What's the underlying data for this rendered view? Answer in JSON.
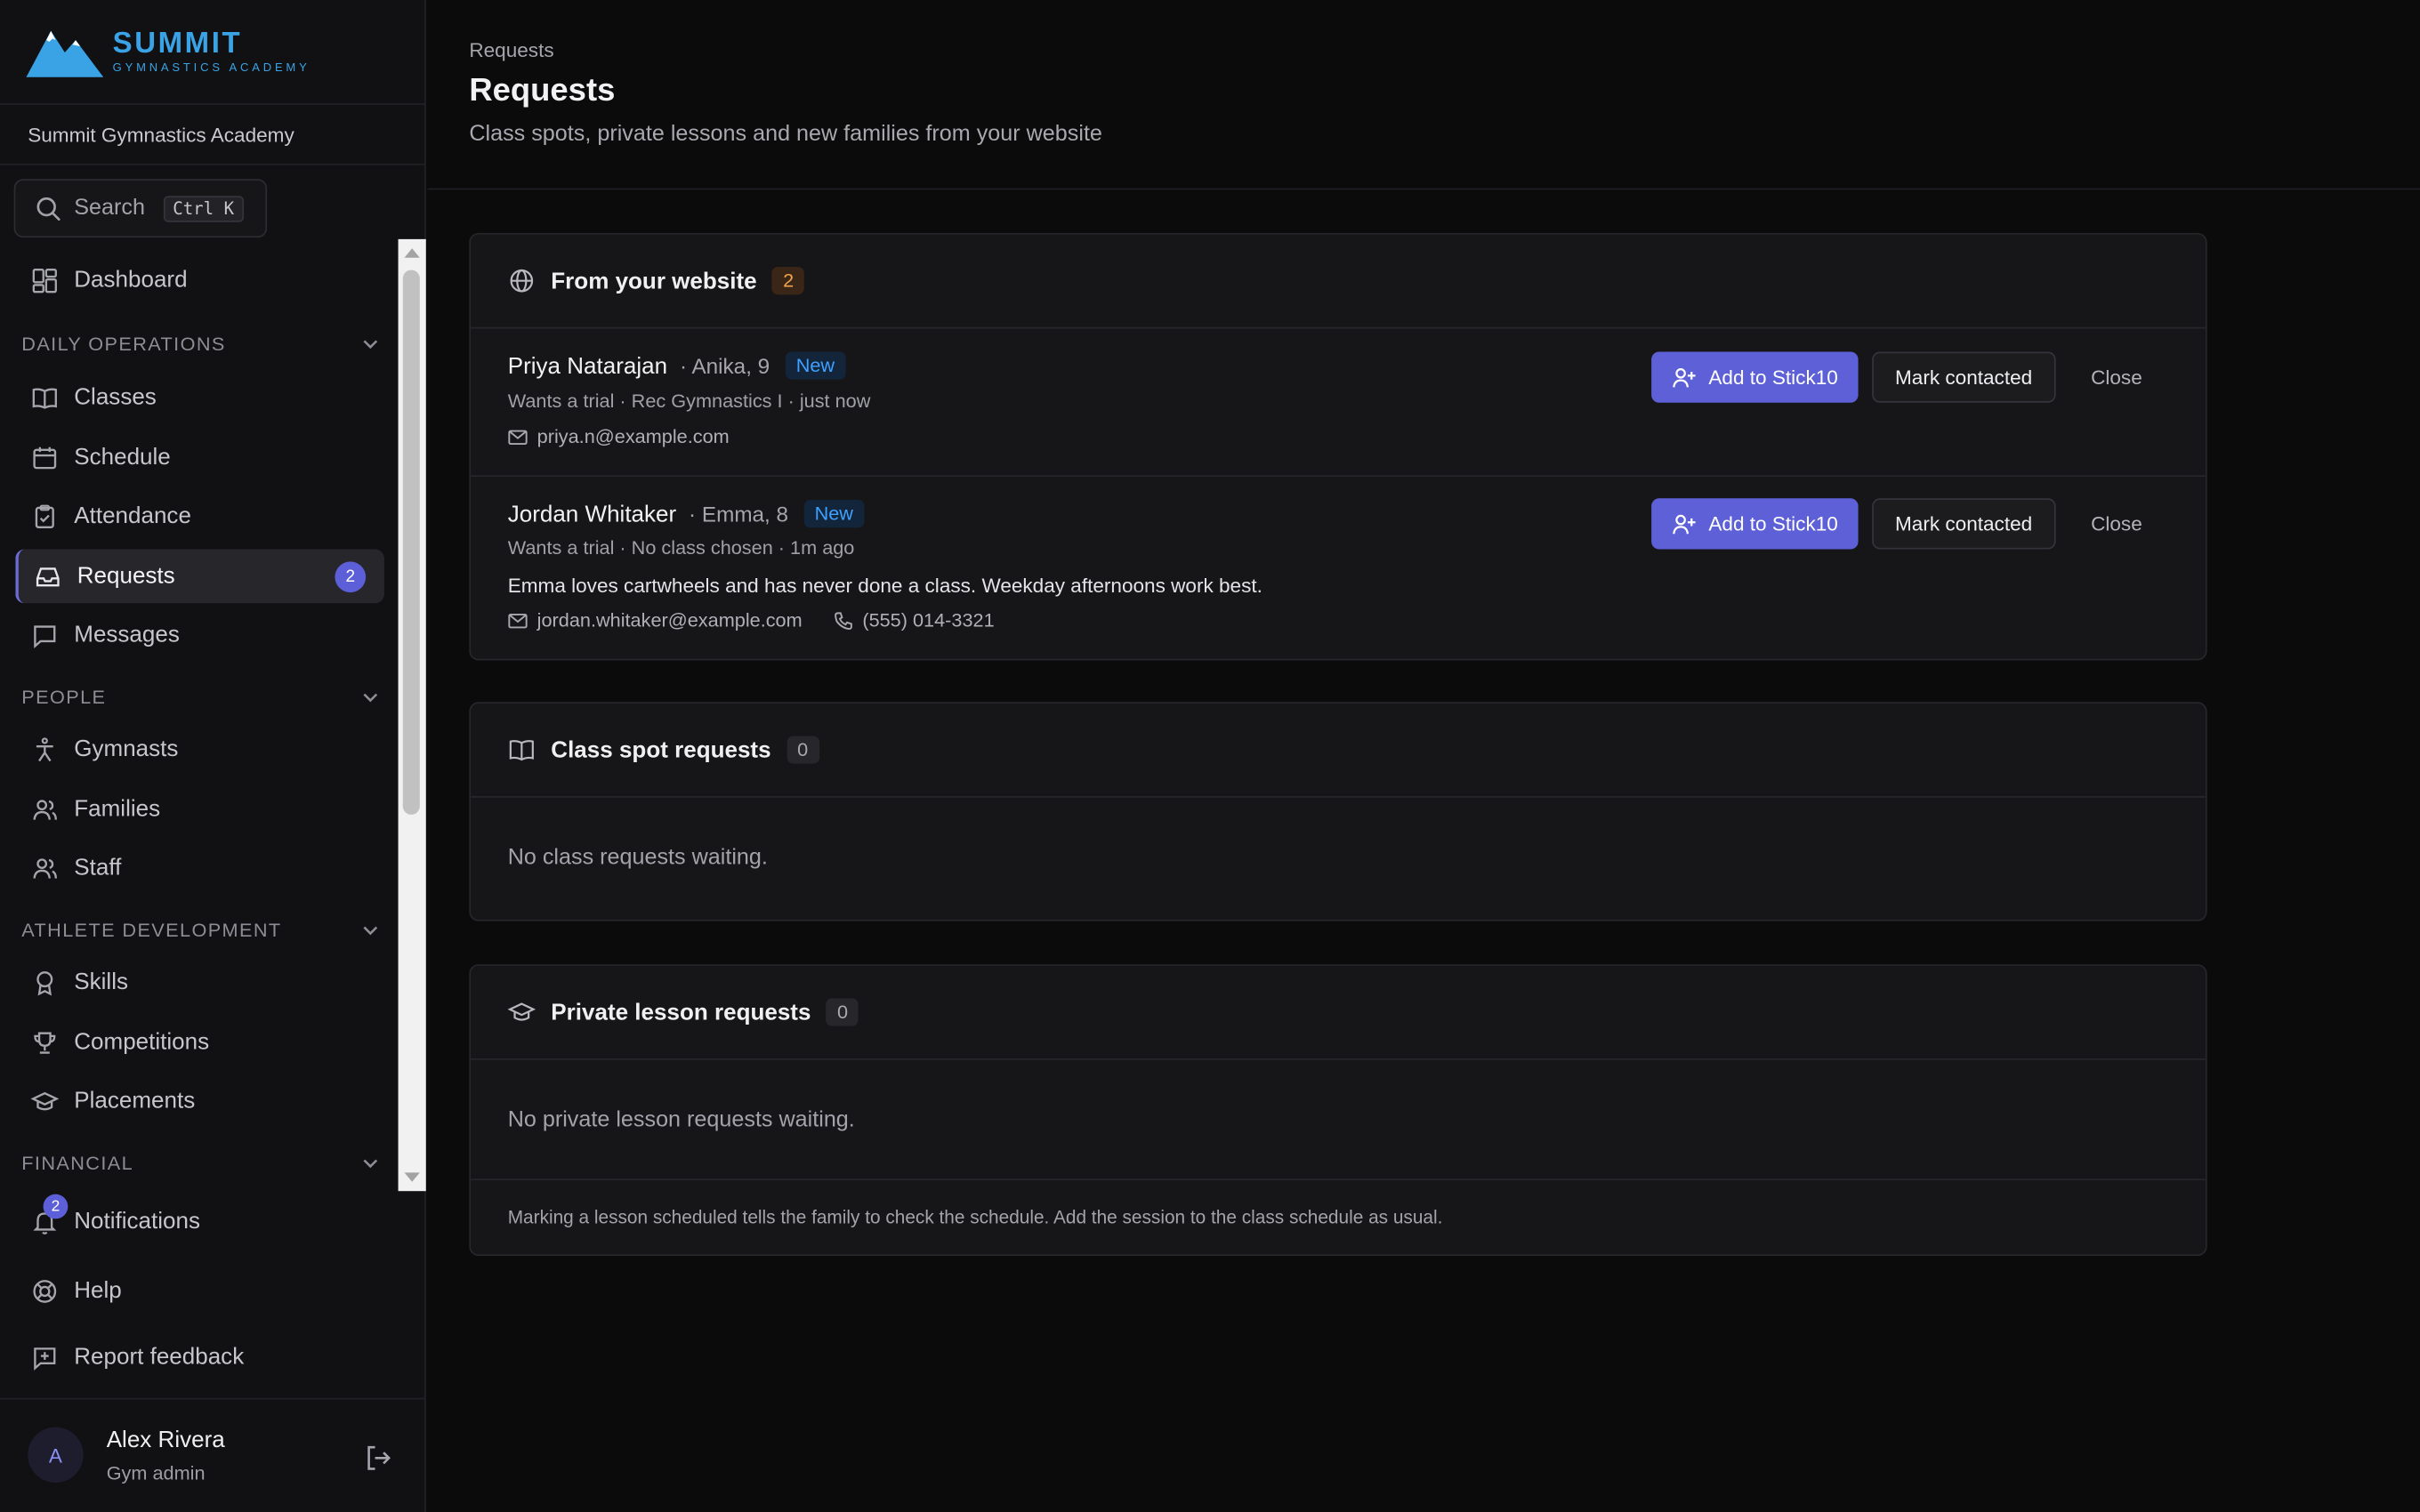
{
  "brand": {
    "name": "SUMMIT",
    "sub": "GYMNASTICS ACADEMY",
    "color": "#3aa3e6"
  },
  "org": "Summit Gymnastics Academy",
  "search": {
    "label": "Search",
    "shortcut": "Ctrl K"
  },
  "nav": {
    "dashboard": "Dashboard",
    "sections": {
      "daily": "DAILY OPERATIONS",
      "people": "PEOPLE",
      "athlete": "ATHLETE DEVELOPMENT",
      "financial": "FINANCIAL"
    },
    "classes": "Classes",
    "schedule": "Schedule",
    "attendance": "Attendance",
    "requests": "Requests",
    "requests_badge": "2",
    "messages": "Messages",
    "gymnasts": "Gymnasts",
    "families": "Families",
    "staff": "Staff",
    "skills": "Skills",
    "competitions": "Competitions",
    "placements": "Placements"
  },
  "bottom": {
    "notifications": "Notifications",
    "notifications_badge": "2",
    "help": "Help",
    "feedback": "Report feedback"
  },
  "user": {
    "initial": "A",
    "name": "Alex Rivera",
    "role": "Gym admin"
  },
  "header": {
    "breadcrumb": "Requests",
    "title": "Requests",
    "subtitle": "Class spots, private lessons and new families from your website"
  },
  "website": {
    "title": "From your website",
    "count": "2",
    "entries": [
      {
        "name": "Priya Natarajan",
        "child": "· Anika, 9",
        "tag": "New",
        "meta": "Wants a trial · Rec Gymnastics I · just now",
        "email": "priya.n@example.com"
      },
      {
        "name": "Jordan Whitaker",
        "child": "· Emma, 8",
        "tag": "New",
        "meta": "Wants a trial · No class chosen · 1m ago",
        "note": "Emma loves cartwheels and has never done a class. Weekday afternoons work best.",
        "email": "jordan.whitaker@example.com",
        "phone": "(555) 014-3321"
      }
    ],
    "add_label": "Add to Stick10",
    "contacted_label": "Mark contacted",
    "close_label": "Close"
  },
  "class_spot": {
    "title": "Class spot requests",
    "count": "0",
    "empty": "No class requests waiting."
  },
  "private_lesson": {
    "title": "Private lesson requests",
    "count": "0",
    "empty": "No private lesson requests waiting.",
    "footnote": "Marking a lesson scheduled tells the family to check the schedule. Add the session to the class schedule as usual."
  },
  "colors": {
    "accent": "#5d60d6",
    "new_tag": "#3fa1ff",
    "count_orange": "#f0a24d"
  }
}
